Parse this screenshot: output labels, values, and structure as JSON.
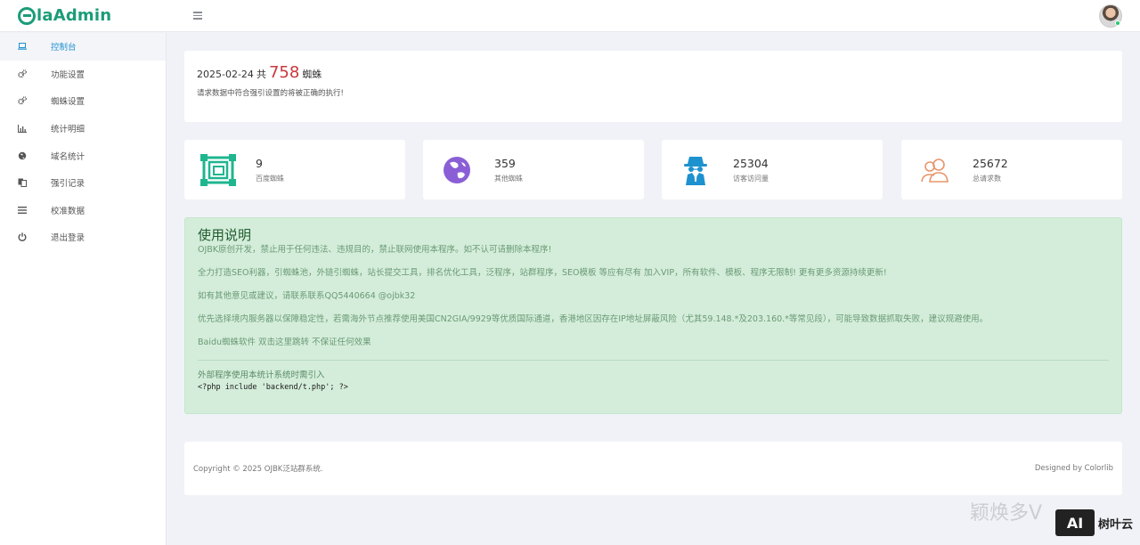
{
  "header": {
    "logo_text": "laAdmin",
    "menu_icon": "hamburger-icon"
  },
  "sidebar": {
    "items": [
      {
        "label": "控制台",
        "icon": "laptop-icon",
        "active": true
      },
      {
        "label": "功能设置",
        "icon": "cogs-icon"
      },
      {
        "label": "蜘蛛设置",
        "icon": "cogs-icon"
      },
      {
        "label": "统计明细",
        "icon": "bar-chart-icon"
      },
      {
        "label": "域名统计",
        "icon": "globe-icon"
      },
      {
        "label": "强引记录",
        "icon": "copy-icon"
      },
      {
        "label": "校准数据",
        "icon": "list-icon"
      },
      {
        "label": "退出登录",
        "icon": "power-icon"
      }
    ]
  },
  "summary": {
    "date": "2025-02-24",
    "gong": "共",
    "count": "758",
    "unit": "蜘蛛",
    "note": "请求数据中符合强引设置的将被正确的执行!"
  },
  "stats": [
    {
      "value": "9",
      "label": "百度蜘蛛",
      "icon": "frame-icon",
      "color": "#1fb58f"
    },
    {
      "value": "359",
      "label": "其他蜘蛛",
      "icon": "globe-icon",
      "color": "#8a5fd6"
    },
    {
      "value": "25304",
      "label": "访客访问量",
      "icon": "spy-icon",
      "color": "#1e91cf"
    },
    {
      "value": "25672",
      "label": "总请求数",
      "icon": "users-icon",
      "color": "#e8956a"
    }
  ],
  "notice": {
    "title": "使用说明",
    "p1": "OJBK原创开发，禁止用于任何违法、违规目的，禁止联网使用本程序。如不认可请删除本程序!",
    "p2": "全力打造SEO利器，引蜘蛛池，外链引蜘蛛，站长提交工具，排名优化工具，泛程序，站群程序，SEO模板 等应有尽有 加入VIP，所有软件、模板、程序无限制! 更有更多资源持续更新!",
    "p3": "如有其他意见或建议，请联系联系QQ5440664 @ojbk32",
    "p4": "优先选择境内服务器以保障稳定性，若需海外节点推荐使用美国CN2GIA/9929等优质国际通道，香港地区因存在IP地址屏蔽风险（尤其59.148.*及203.160.*等常见段），可能导致数据抓取失败，建议规避使用。",
    "p5": "Baidu蜘蛛软件 双击这里跳转 不保证任何效果",
    "sub": "外部程序使用本统计系统时需引入",
    "code": "<?php include 'backend/t.php'; ?>"
  },
  "footer": {
    "copyright": "Copyright © 2025 OJBK泛站群系统.",
    "designed": "Designed by Colorlib"
  },
  "overlay": {
    "watermark": "颖焕多V",
    "badge": "AI",
    "badge_text": "树叶云"
  }
}
